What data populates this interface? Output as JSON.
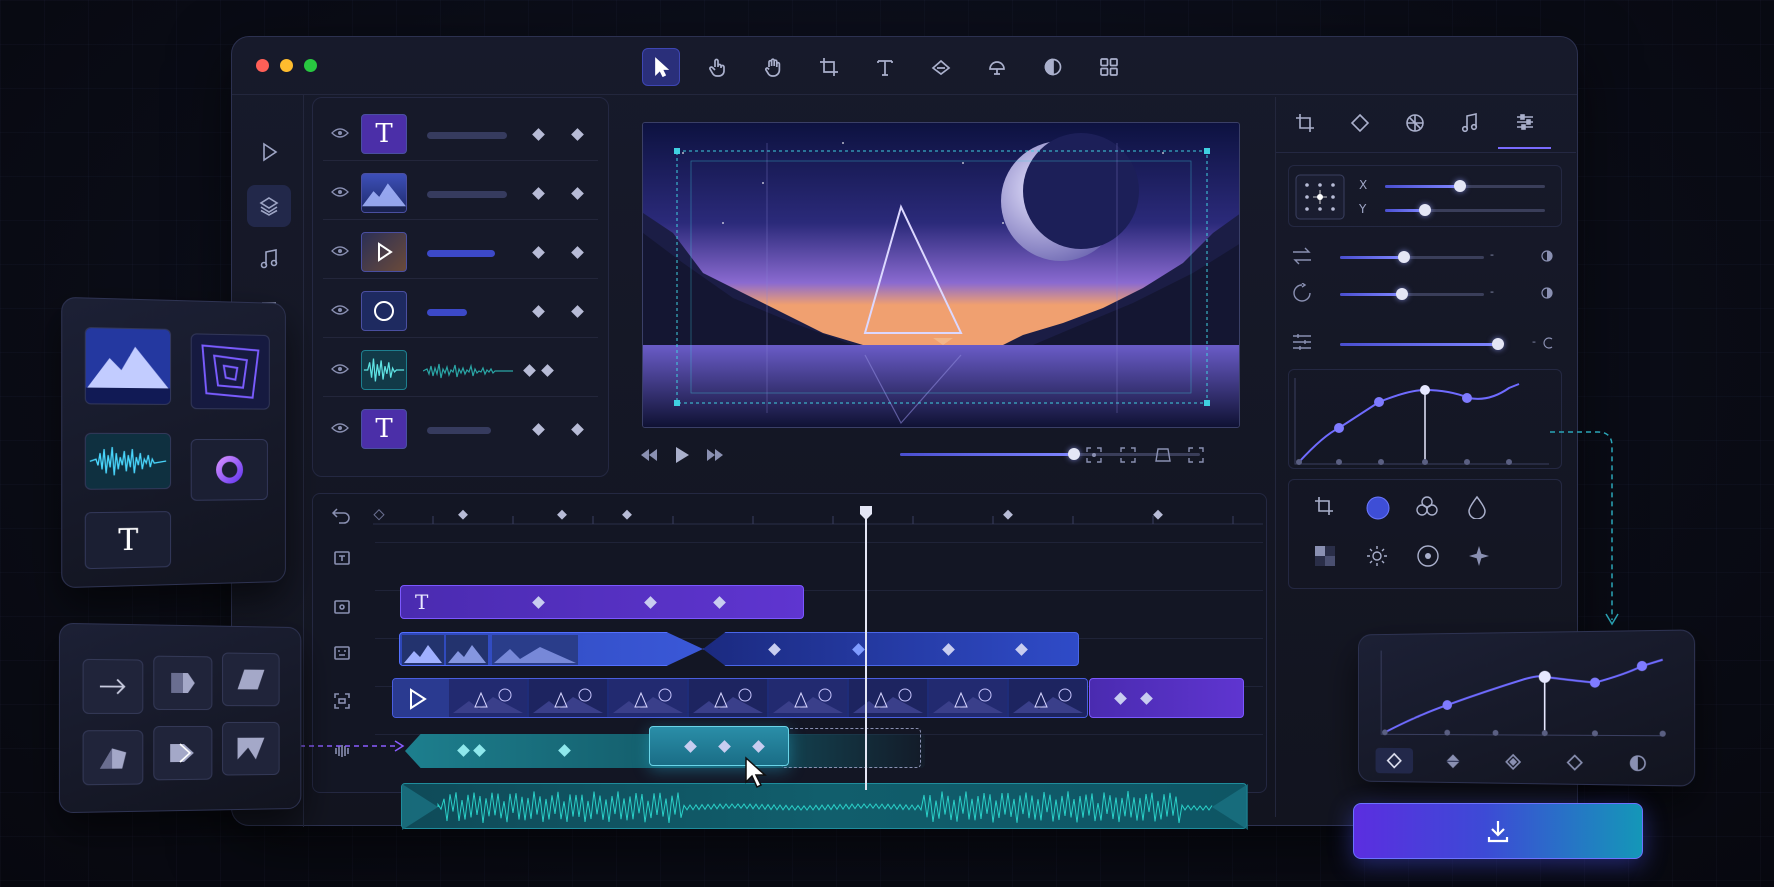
{
  "toolbar": {
    "tools": [
      {
        "name": "select-tool",
        "icon": "cursor-icon",
        "active": true
      },
      {
        "name": "pan-tool",
        "icon": "hand-pointer-icon"
      },
      {
        "name": "grab-tool",
        "icon": "hand-icon"
      },
      {
        "name": "crop-tool",
        "icon": "crop-icon"
      },
      {
        "name": "text-tool",
        "icon": "text-icon"
      },
      {
        "name": "mask-tool",
        "icon": "mask-icon"
      },
      {
        "name": "shape-tool",
        "icon": "shape-icon"
      },
      {
        "name": "color-tool",
        "icon": "color-icon"
      },
      {
        "name": "grid-tool",
        "icon": "grid-icon"
      }
    ]
  },
  "left_sidebar": {
    "items": [
      "play-icon",
      "layers-icon",
      "music-note-icon",
      "text-icon"
    ],
    "active": "layers-icon"
  },
  "layers": {
    "text_glyph": "T",
    "rows": [
      {
        "type": "text",
        "visible": true,
        "progress": 0.5
      },
      {
        "type": "image",
        "visible": true,
        "progress": 0.5
      },
      {
        "type": "video",
        "visible": true,
        "progress": 0.4
      },
      {
        "type": "shape",
        "visible": true,
        "progress": 0.2
      },
      {
        "type": "audio",
        "visible": true,
        "progress": 0.6
      },
      {
        "type": "text",
        "visible": true,
        "progress": 0.4
      }
    ]
  },
  "transport": {
    "playhead_progress": 0.58
  },
  "right_panel": {
    "tabs": [
      "crop-icon",
      "keyframe-icon",
      "color-wheel-icon",
      "music-note-icon",
      "sliders-icon"
    ],
    "active_tab": "sliders-icon",
    "position": {
      "x_label": "X",
      "y_label": "Y",
      "x_value": 0.47,
      "y_value": 0.25
    },
    "adjustments": [
      0.45,
      0.43,
      0.9
    ]
  },
  "effects": [
    "crop-icon",
    "blur-icon",
    "blend-icon",
    "drop-icon",
    "mask-square-icon",
    "sparkle-icon",
    "vignette-icon",
    "sharpen-icon"
  ],
  "timeline": {
    "text_glyph": "T"
  },
  "assets_panel": {
    "text_glyph": "T"
  },
  "colors": {
    "accent": "#5b4df0",
    "teal": "#1f8c9c",
    "panel": "#161929",
    "background": "#0a0c16"
  }
}
